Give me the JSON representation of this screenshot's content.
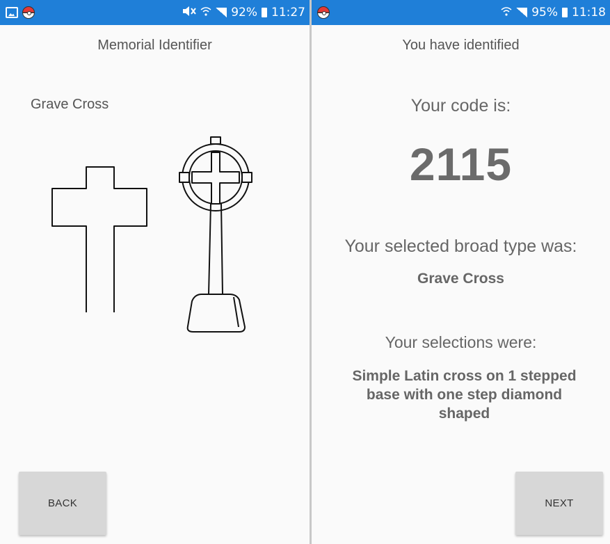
{
  "left_screen": {
    "status_bar": {
      "left_icons": [
        "gallery-icon",
        "pokeball-icon"
      ],
      "right_icons": [
        "mute-icon",
        "wifi-icon",
        "signal-icon"
      ],
      "battery": "92%",
      "time": "11:27"
    },
    "title": "Memorial Identifier",
    "type_label": "Grave Cross",
    "back_label": "BACK"
  },
  "right_screen": {
    "status_bar": {
      "left_icons": [
        "pokeball-icon"
      ],
      "right_icons": [
        "wifi-icon",
        "signal-icon"
      ],
      "battery": "95%",
      "time": "11:18"
    },
    "title": "You have identified",
    "code_label": "Your code is:",
    "code_value": "2115",
    "broad_type_label": "Your selected broad type was:",
    "broad_type_value": "Grave Cross",
    "selections_label": "Your selections were:",
    "selections_value": "Simple Latin cross on 1 stepped base with one step diamond shaped",
    "next_label": "NEXT"
  },
  "colors": {
    "status_bar": "#1f7fd8",
    "background": "#fafafa",
    "button": "#d7d7d7",
    "text": "#555555"
  }
}
